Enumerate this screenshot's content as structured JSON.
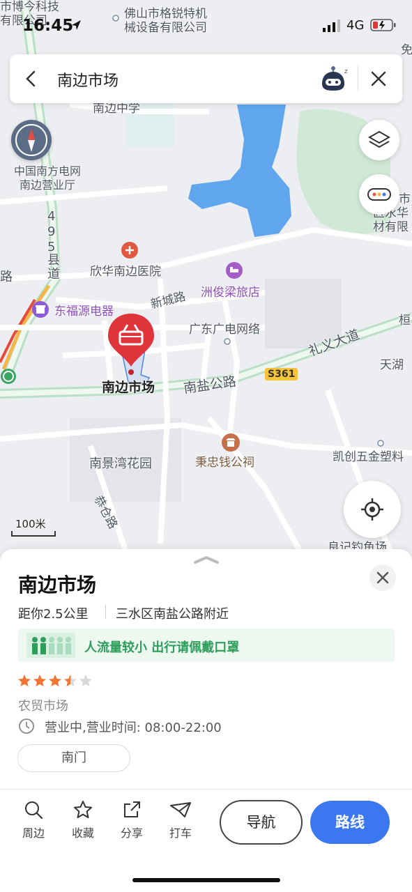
{
  "status": {
    "time": "16:45",
    "network": "4G"
  },
  "search": {
    "query": "南边市场"
  },
  "map": {
    "labels": {
      "bobo": "市博今科技",
      "bobo2": "有限公司",
      "gerui1": "佛山市格锐特机",
      "gerui2": "械设备有限公司",
      "school": "南边中学",
      "grid1": "中国南方电网",
      "grid2": "南边营业厅",
      "county1": "495",
      "county2": "县道",
      "hospital": "欣华南边医院",
      "hotel": "洲俊梁旅店",
      "xincheng": "新城路",
      "dongfu": "东福源电器",
      "gdnet": "广东广电网络",
      "liyi": "礼义大道",
      "market": "南边市场",
      "nanyan": "南盐公路",
      "s361": "S361",
      "tianhu": "天湖",
      "heng": "桓",
      "right1": "市",
      "right2": "区永华",
      "right3": "材有限",
      "kaichuang": "凯创五金塑料",
      "nanjing": "南景湾花园",
      "ancestral": "秉忠钱公祠",
      "gongcang": "恭仓路",
      "road_left": "路",
      "bottom_right": "良记钓鱼场",
      "scale": "100米",
      "right_edge": "免"
    }
  },
  "place": {
    "name": "南边市场",
    "distance": "距你2.5公里",
    "address": "三水区南盐公路附近",
    "crowd_notice": "人流量较小 出行请佩戴口罩",
    "rating": 3.5,
    "category": "农贸市场",
    "hours": "营业中,营业时间: 08:00-22:00",
    "gate": "南门"
  },
  "toolbar": {
    "nearby": "周边",
    "favorite": "收藏",
    "share": "分享",
    "taxi": "打车",
    "navigate": "导航",
    "route": "路线"
  },
  "colors": {
    "accent": "#3b78f0",
    "marker": "#e0343b",
    "green_notice": "#2e9e5b",
    "star": "#f07534"
  }
}
